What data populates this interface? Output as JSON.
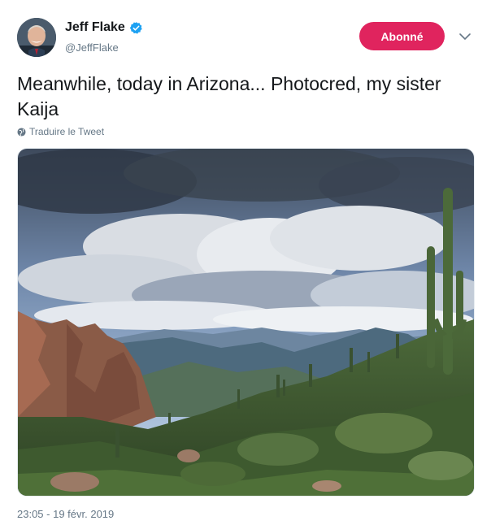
{
  "author": {
    "name": "Jeff Flake",
    "handle": "@JeffFlake",
    "verified": true,
    "avatar_icon": "profile-photo"
  },
  "follow_button": {
    "label": "Abonné",
    "color": "#e0245e"
  },
  "menu_icon": "chevron-down-icon",
  "tweet": {
    "text": "Meanwhile, today in Arizona... Photocred, my sister Kaija",
    "translate_label": "Traduire le Tweet",
    "timestamp": "23:05 - 19 févr. 2019"
  },
  "colors": {
    "accent": "#1da1f2",
    "secondary_text": "#657786",
    "primary_text": "#14171a"
  }
}
